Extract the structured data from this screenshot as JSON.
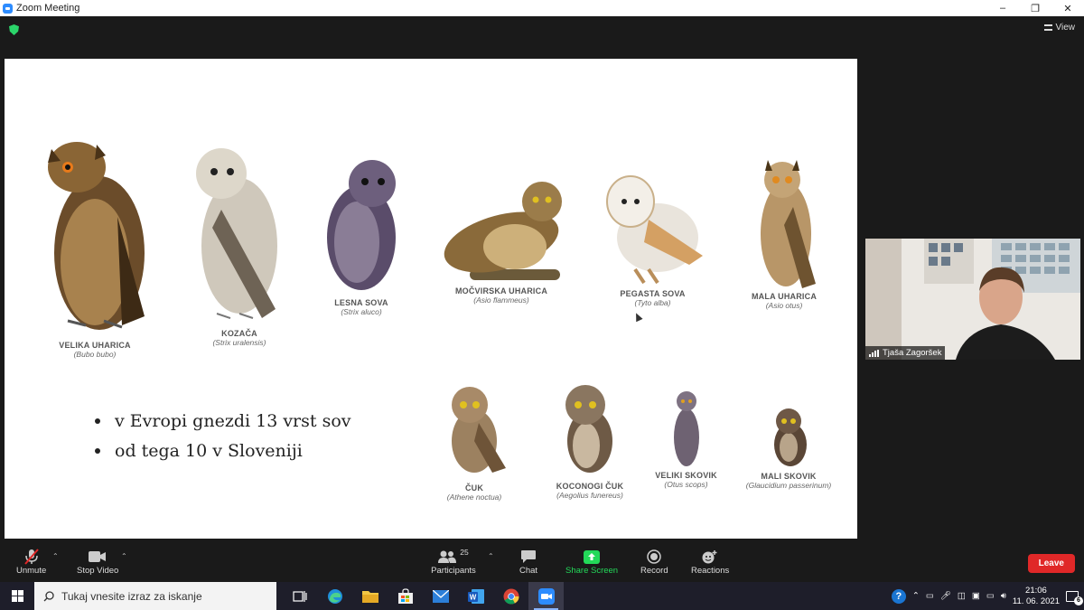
{
  "window": {
    "title": "Zoom Meeting",
    "minimize": "–",
    "restore": "❐",
    "close": "✕"
  },
  "view_label": "View",
  "slide": {
    "owls": [
      {
        "name": "VELIKA UHARICA",
        "latin": "(Bubo bubo)"
      },
      {
        "name": "KOZAČA",
        "latin": "(Strix uralensis)"
      },
      {
        "name": "LESNA SOVA",
        "latin": "(Strix aluco)"
      },
      {
        "name": "MOČVIRSKA UHARICA",
        "latin": "(Asio flammeus)"
      },
      {
        "name": "PEGASTA SOVA",
        "latin": "(Tyto alba)"
      },
      {
        "name": "MALA UHARICA",
        "latin": "(Asio otus)"
      },
      {
        "name": "ČUK",
        "latin": "(Athene noctua)"
      },
      {
        "name": "KOCONOGI ČUK",
        "latin": "(Aegolius funereus)"
      },
      {
        "name": "VELIKI SKOVIK",
        "latin": "(Otus scops)"
      },
      {
        "name": "MALI SKOVIK",
        "latin": "(Glaucidium passerinum)"
      }
    ],
    "bullets": [
      "v Evropi gnezdi 13 vrst sov",
      "od tega 10 v Sloveniji"
    ]
  },
  "participant": {
    "name": "Tjaša Zagoršek"
  },
  "toolbar": {
    "unmute": "Unmute",
    "stop_video": "Stop Video",
    "participants": "Participants",
    "participants_count": "25",
    "chat": "Chat",
    "share_screen": "Share Screen",
    "record": "Record",
    "reactions": "Reactions",
    "leave": "Leave"
  },
  "taskbar": {
    "search_placeholder": "Tukaj vnesite izraz za iskanje",
    "time": "21:06",
    "date": "11. 06. 2021",
    "notifications": "6",
    "help": "?"
  },
  "colors": {
    "share_green": "#23d959",
    "leave_red": "#e02828",
    "zoom_blue": "#2d8cff"
  }
}
